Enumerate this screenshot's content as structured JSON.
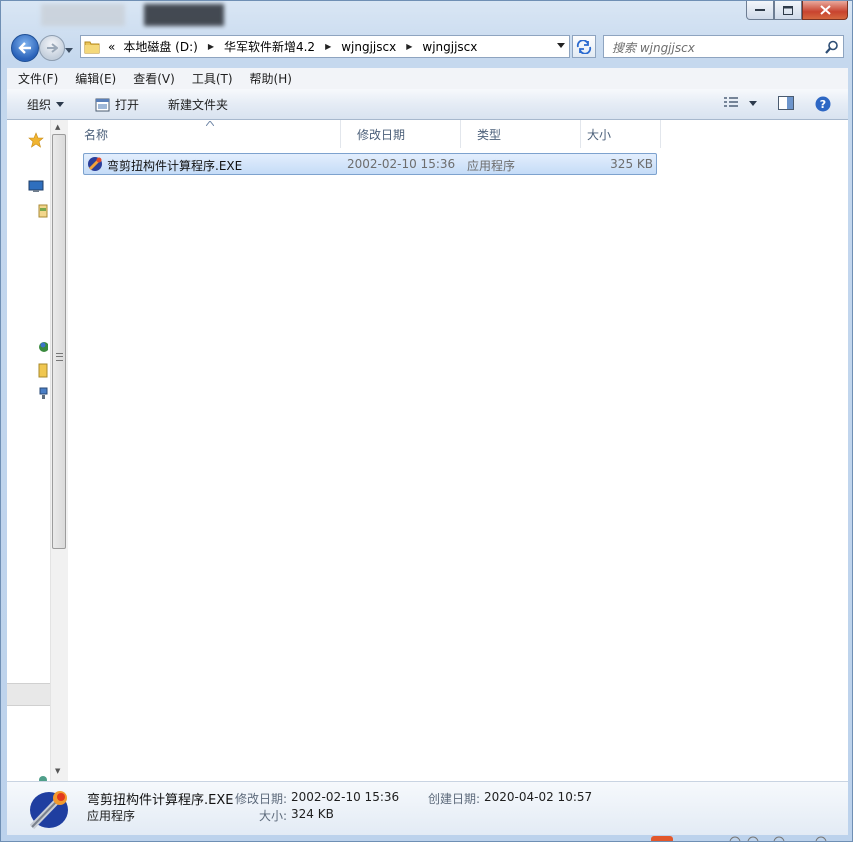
{
  "window": {
    "controls": {
      "minimize": "minimize",
      "maximize": "maximize",
      "close": "close"
    }
  },
  "address": {
    "overflow": "«",
    "crumbs": [
      "本地磁盘 (D:)",
      "华军软件新增4.2",
      "wjngjjscx",
      "wjngjjscx"
    ]
  },
  "search": {
    "placeholder": "搜索 wjngjjscx"
  },
  "menu": [
    "文件(F)",
    "编辑(E)",
    "查看(V)",
    "工具(T)",
    "帮助(H)"
  ],
  "commands": {
    "organize": "组织",
    "open": "打开",
    "new_folder": "新建文件夹"
  },
  "columns": {
    "name": "名称",
    "modified": "修改日期",
    "type": "类型",
    "size": "大小"
  },
  "files": [
    {
      "name": "弯剪扭构件计算程序.EXE",
      "modified": "2002-02-10 15:36",
      "type": "应用程序",
      "size": "325 KB",
      "selected": true
    }
  ],
  "details": {
    "name": "弯剪扭构件计算程序.EXE",
    "type": "应用程序",
    "modified_label": "修改日期:",
    "modified": "2002-02-10 15:36",
    "size_label": "大小:",
    "size": "324 KB",
    "created_label": "创建日期:",
    "created": "2020-04-02 10:57"
  },
  "colors": {
    "accent": "#2a62b9",
    "selection": "#c5dcf7",
    "frame": "#c5d8ee"
  }
}
